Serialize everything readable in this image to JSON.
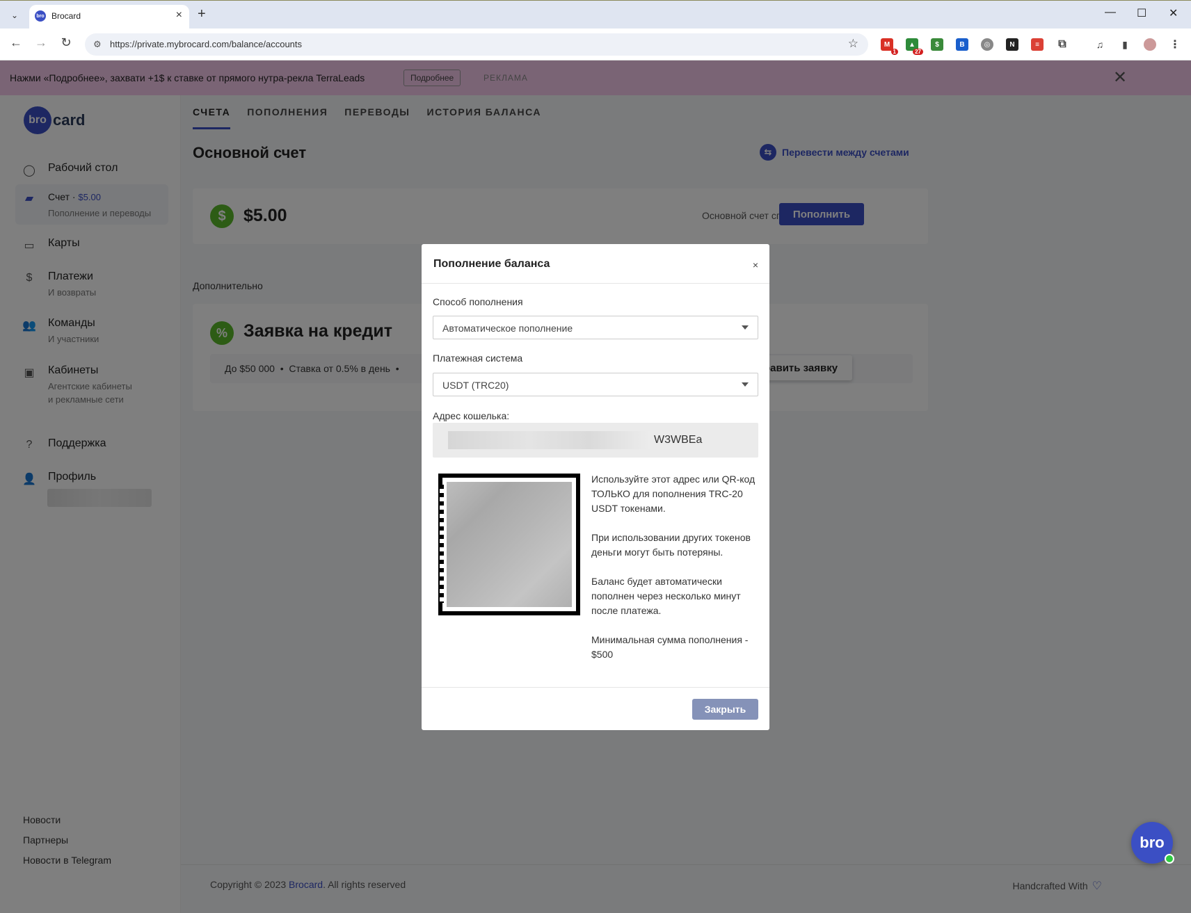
{
  "browser": {
    "tab_title": "Brocard",
    "url": "https://private.mybrocard.com/balance/accounts",
    "extensions": [
      {
        "name": "gmail-ext",
        "badge": "1",
        "color": "#d93025"
      },
      {
        "name": "green-ext",
        "badge": "27",
        "color": "#2e8b3a"
      },
      {
        "name": "money-ext",
        "badge": "",
        "color": "#3a8a3a"
      },
      {
        "name": "blue-ext",
        "badge": "",
        "color": "#1a5fcc"
      },
      {
        "name": "gray-ext",
        "badge": "",
        "color": "#888888"
      },
      {
        "name": "notion-ext",
        "badge": "",
        "color": "#222222"
      },
      {
        "name": "todoist-ext",
        "badge": "",
        "color": "#db4035"
      }
    ]
  },
  "ad": {
    "text": "Нажми «Подробнее», захвати +1$ к ставке от прямого нутра-рекла TerraLeads",
    "button": "Подробнее",
    "tag": "РЕКЛАМА"
  },
  "sidebar": {
    "logo_circle": "bro",
    "logo_text": "card",
    "items": [
      {
        "label": "Рабочий стол",
        "sub": ""
      },
      {
        "label": "Счет · ",
        "amount": "$5.00",
        "sub": "Пополнение и переводы"
      },
      {
        "label": "Карты",
        "sub": ""
      },
      {
        "label": "Платежи",
        "sub": "И возвраты"
      },
      {
        "label": "Команды",
        "sub": "И участники"
      },
      {
        "label": "Кабинеты",
        "sub": "Агентские кабинеты",
        "sub2": "и рекламные сети"
      },
      {
        "label": "Поддержка",
        "sub": ""
      },
      {
        "label": "Профиль",
        "sub": ""
      }
    ],
    "bottom_links": [
      "Новости",
      "Партнеры",
      "Новости в Telegram"
    ]
  },
  "main": {
    "tabs": [
      "СЧЕТА",
      "ПОПОЛНЕНИЯ",
      "ПЕРЕВОДЫ",
      "ИСТОРИЯ БАЛАНСА"
    ],
    "title": "Основной счет",
    "transfer_link": "Перевести между счетами",
    "balance": "$5.00",
    "balance_note": "Основной счет списания",
    "topup_button": "Пополнить",
    "extra_label": "Дополнительно",
    "credit_title": "Заявка на кредит",
    "credit_terms": "До $50 000  •  Ставка от 0.5% в день  •",
    "credit_button": "Отправить заявку"
  },
  "footer": {
    "copyright_prefix": "Copyright © 2023 ",
    "brand": "Brocard",
    "copyright_suffix": ". All rights reserved",
    "handcrafted": "Handcrafted With"
  },
  "modal": {
    "title": "Пополнение баланса",
    "close_x": "×",
    "method_label": "Способ пополнения",
    "method_value": "Автоматическое пополнение",
    "system_label": "Платежная система",
    "system_value": "USDT (TRC20)",
    "wallet_label": "Адрес кошелька:",
    "wallet_visible": "W3WBEa",
    "info": [
      "Используйте этот адрес или QR-код ТОЛЬКО для пополнения TRC-20 USDT токенами.",
      "При использовании других токенов деньги могут быть потеряны.",
      "Баланс будет автоматически пополнен через несколько минут после платежа.",
      "Минимальная сумма пополнения - $500"
    ],
    "close_button": "Закрыть"
  },
  "chat_badge": "bro"
}
